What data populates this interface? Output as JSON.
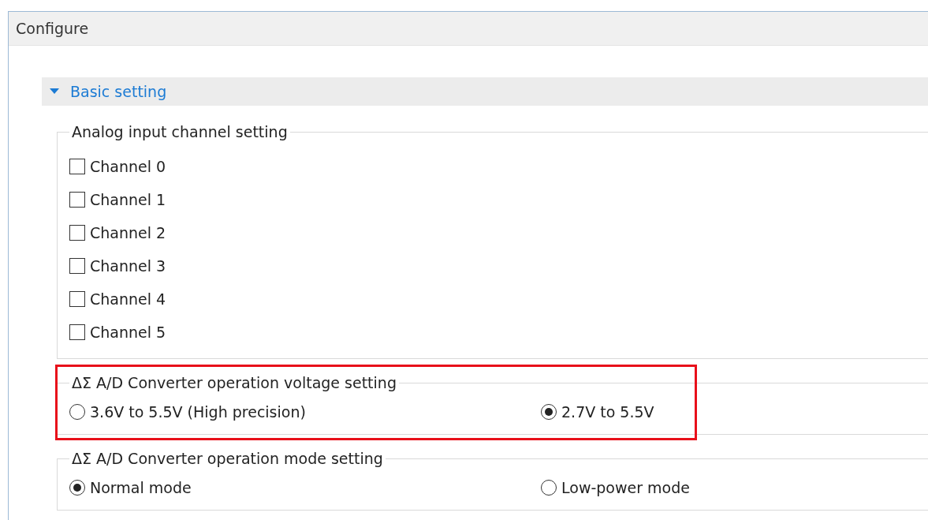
{
  "window": {
    "title": "Configure"
  },
  "section": {
    "title": "Basic setting",
    "expanded": true
  },
  "groups": [
    {
      "kind": "checkboxes",
      "title": "Analog input channel setting",
      "highlighted": false,
      "options": [
        {
          "label": "Channel 0",
          "checked": false
        },
        {
          "label": "Channel 1",
          "checked": false
        },
        {
          "label": "Channel 2",
          "checked": false
        },
        {
          "label": "Channel 3",
          "checked": false
        },
        {
          "label": "Channel 4",
          "checked": false
        },
        {
          "label": "Channel 5",
          "checked": false
        }
      ]
    },
    {
      "kind": "radios",
      "title": "ΔΣ A/D Converter operation voltage setting",
      "highlighted": true,
      "options": [
        {
          "label": "3.6V to 5.5V (High precision)",
          "selected": false
        },
        {
          "label": "2.7V to 5.5V",
          "selected": true
        }
      ]
    },
    {
      "kind": "radios",
      "title": "ΔΣ A/D Converter operation mode setting",
      "highlighted": false,
      "options": [
        {
          "label": "Normal mode",
          "selected": true
        },
        {
          "label": "Low-power mode",
          "selected": false
        }
      ]
    }
  ]
}
